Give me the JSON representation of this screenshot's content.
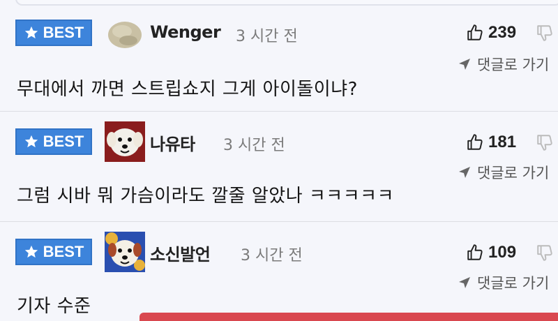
{
  "comments": [
    {
      "badge": "BEST",
      "username": "Wenger",
      "time": "3 시간 전",
      "likes": "239",
      "reply_label": "댓글로 가기",
      "text": "무대에서 까면 스트립쇼지 그게 아이돌이냐?",
      "avatar_icon": "rock-avatar-icon"
    },
    {
      "badge": "BEST",
      "username": "나유타",
      "time": "3 시간 전",
      "likes": "181",
      "reply_label": "댓글로 가기",
      "text": "그럼 시바 뭐 가슴이라도 깔줄 알았나 ㅋㅋㅋㅋㅋ",
      "avatar_icon": "dog-avatar-icon"
    },
    {
      "badge": "BEST",
      "username": "소신발언",
      "time": "3 시간 전",
      "likes": "109",
      "reply_label": "댓글로 가기",
      "text": "기자 수준",
      "avatar_icon": "dog-avatar-icon"
    }
  ],
  "colors": {
    "badge": "#3d84db",
    "background": "#f5f6fb",
    "accent_bar": "#d9484f"
  }
}
